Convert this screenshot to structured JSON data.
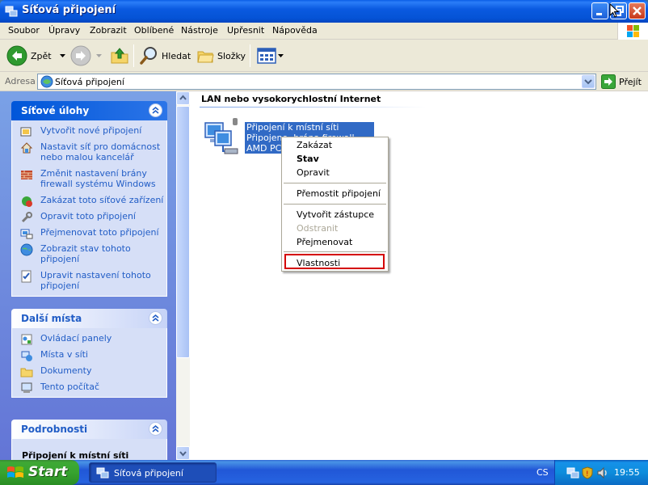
{
  "window": {
    "title": "Síťová připojení"
  },
  "menu": [
    "Soubor",
    "Úpravy",
    "Zobrazit",
    "Oblíbené",
    "Nástroje",
    "Upřesnit",
    "Nápověda"
  ],
  "toolbar": {
    "back": "Zpět",
    "search": "Hledat",
    "folders": "Složky"
  },
  "address": {
    "label": "Adresa",
    "value": "Síťová připojení",
    "go": "Přejít"
  },
  "left": {
    "network_tasks": {
      "title": "Síťové úlohy",
      "items": [
        [
          "Vytvořit nové připojení"
        ],
        [
          "Nastavit síť pro domácnost",
          "nebo malou kancelář"
        ],
        [
          "Změnit nastavení brány",
          "firewall systému Windows"
        ],
        [
          "Zakázat toto síťové zařízení"
        ],
        [
          "Opravit toto připojení"
        ],
        [
          "Přejmenovat toto připojení"
        ],
        [
          "Zobrazit stav tohoto",
          "připojení"
        ],
        [
          "Upravit nastavení tohoto",
          "připojení"
        ]
      ]
    },
    "other_places": {
      "title": "Další místa",
      "items": [
        "Ovládací panely",
        "Místa v síti",
        "Dokumenty",
        "Tento počítač"
      ]
    },
    "details": {
      "title": "Podrobnosti",
      "item": "Připojení k místní síti"
    }
  },
  "content": {
    "group_title": "LAN nebo vysokorychlostní Internet",
    "connection": {
      "line1": "Připojení k místní síti",
      "line2": "Připojeno, brána firewall",
      "line3": "AMD PCN"
    }
  },
  "context_menu": {
    "items": [
      "Zakázat",
      "Stav",
      "Opravit",
      "Přemostit připojení",
      "Vytvořit zástupce",
      "Odstranit",
      "Přejmenovat",
      "Vlastnosti"
    ]
  },
  "taskbar": {
    "start": "Start",
    "task": "Síťová připojení",
    "lang": "CS",
    "clock": "19:55"
  }
}
